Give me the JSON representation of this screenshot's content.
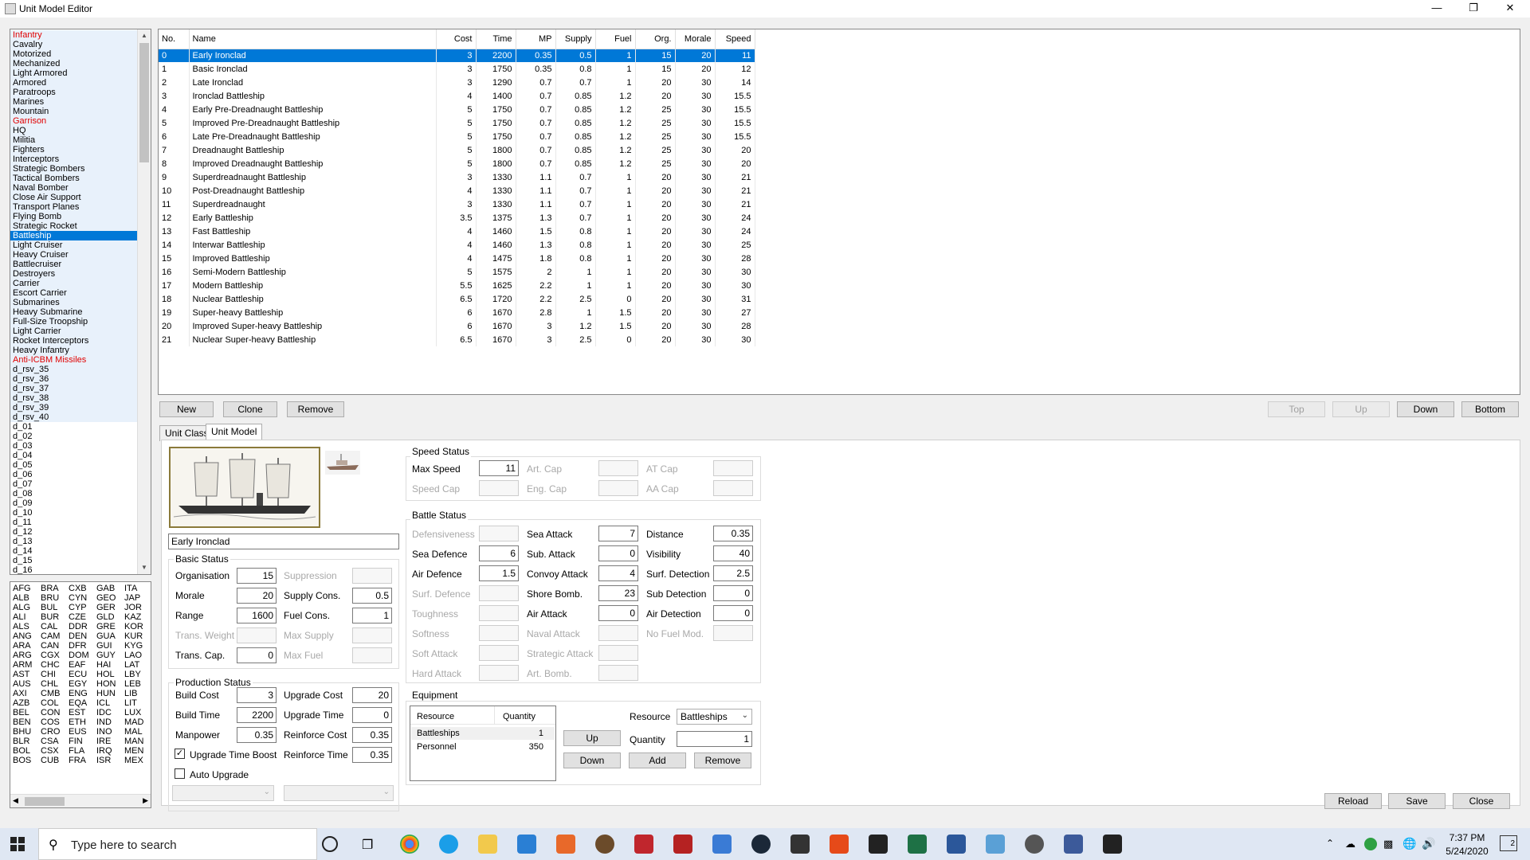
{
  "window": {
    "title": "Unit Model Editor"
  },
  "class_list": [
    {
      "label": "Infantry",
      "red": true
    },
    {
      "label": "Cavalry"
    },
    {
      "label": "Motorized"
    },
    {
      "label": "Mechanized"
    },
    {
      "label": "Light Armored"
    },
    {
      "label": "Armored"
    },
    {
      "label": "Paratroops"
    },
    {
      "label": "Marines"
    },
    {
      "label": "Mountain"
    },
    {
      "label": "Garrison",
      "red": true
    },
    {
      "label": "HQ"
    },
    {
      "label": "Militia"
    },
    {
      "label": "Fighters"
    },
    {
      "label": "Interceptors"
    },
    {
      "label": "Strategic Bombers"
    },
    {
      "label": "Tactical Bombers"
    },
    {
      "label": "Naval Bomber"
    },
    {
      "label": "Close Air Support"
    },
    {
      "label": "Transport Planes"
    },
    {
      "label": "Flying Bomb"
    },
    {
      "label": "Strategic Rocket"
    },
    {
      "label": "Battleship",
      "selected": true
    },
    {
      "label": "Light Cruiser"
    },
    {
      "label": "Heavy Cruiser"
    },
    {
      "label": "Battlecruiser"
    },
    {
      "label": "Destroyers"
    },
    {
      "label": "Carrier"
    },
    {
      "label": "Escort Carrier"
    },
    {
      "label": "Submarines"
    },
    {
      "label": "Heavy Submarine"
    },
    {
      "label": "Full-Size Troopship"
    },
    {
      "label": "Light Carrier"
    },
    {
      "label": "Rocket Interceptors"
    },
    {
      "label": "Heavy Infantry"
    },
    {
      "label": "Anti-ICBM Missiles",
      "red": true
    },
    {
      "label": "d_rsv_35"
    },
    {
      "label": "d_rsv_36"
    },
    {
      "label": "d_rsv_37"
    },
    {
      "label": "d_rsv_38"
    },
    {
      "label": "d_rsv_39"
    },
    {
      "label": "d_rsv_40"
    },
    {
      "label": "d_01",
      "plain": true
    },
    {
      "label": "d_02",
      "plain": true
    },
    {
      "label": "d_03",
      "plain": true
    },
    {
      "label": "d_04",
      "plain": true
    },
    {
      "label": "d_05",
      "plain": true
    },
    {
      "label": "d_06",
      "plain": true
    },
    {
      "label": "d_07",
      "plain": true
    },
    {
      "label": "d_08",
      "plain": true
    },
    {
      "label": "d_09",
      "plain": true
    },
    {
      "label": "d_10",
      "plain": true
    },
    {
      "label": "d_11",
      "plain": true
    },
    {
      "label": "d_12",
      "plain": true
    },
    {
      "label": "d_13",
      "plain": true
    },
    {
      "label": "d_14",
      "plain": true
    },
    {
      "label": "d_15",
      "plain": true
    },
    {
      "label": "d_16",
      "plain": true
    }
  ],
  "countries": [
    "AFG",
    "BRA",
    "CXB",
    "GAB",
    "ITA",
    "ALB",
    "BRU",
    "CYN",
    "GEO",
    "JAP",
    "ALG",
    "BUL",
    "CYP",
    "GER",
    "JOR",
    "ALI",
    "BUR",
    "CZE",
    "GLD",
    "KAZ",
    "ALS",
    "CAL",
    "DDR",
    "GRE",
    "KOR",
    "ANG",
    "CAM",
    "DEN",
    "GUA",
    "KUR",
    "ARA",
    "CAN",
    "DFR",
    "GUI",
    "KYG",
    "ARG",
    "CGX",
    "DOM",
    "GUY",
    "LAO",
    "ARM",
    "CHC",
    "EAF",
    "HAI",
    "LAT",
    "AST",
    "CHI",
    "ECU",
    "HOL",
    "LBY",
    "AUS",
    "CHL",
    "EGY",
    "HON",
    "LEB",
    "AXI",
    "CMB",
    "ENG",
    "HUN",
    "LIB",
    "AZB",
    "COL",
    "EQA",
    "ICL",
    "LIT",
    "BEL",
    "CON",
    "EST",
    "IDC",
    "LUX",
    "BEN",
    "COS",
    "ETH",
    "IND",
    "MAD",
    "BHU",
    "CRO",
    "EUS",
    "INO",
    "MAL",
    "BLR",
    "CSA",
    "FIN",
    "IRE",
    "MAN",
    "BOL",
    "CSX",
    "FLA",
    "IRQ",
    "MEN",
    "BOS",
    "CUB",
    "FRA",
    "ISR",
    "MEX"
  ],
  "table": {
    "headers": [
      "No.",
      "Name",
      "Cost",
      "Time",
      "MP",
      "Supply",
      "Fuel",
      "Org.",
      "Morale",
      "Speed"
    ],
    "rows": [
      [
        "0",
        "Early Ironclad",
        "3",
        "2200",
        "0.35",
        "0.5",
        "1",
        "15",
        "20",
        "11"
      ],
      [
        "1",
        "Basic Ironclad",
        "3",
        "1750",
        "0.35",
        "0.8",
        "1",
        "15",
        "20",
        "12"
      ],
      [
        "2",
        "Late Ironclad",
        "3",
        "1290",
        "0.7",
        "0.7",
        "1",
        "20",
        "30",
        "14"
      ],
      [
        "3",
        "Ironclad Battleship",
        "4",
        "1400",
        "0.7",
        "0.85",
        "1.2",
        "20",
        "30",
        "15.5"
      ],
      [
        "4",
        "Early Pre-Dreadnaught Battleship",
        "5",
        "1750",
        "0.7",
        "0.85",
        "1.2",
        "25",
        "30",
        "15.5"
      ],
      [
        "5",
        "Improved Pre-Dreadnaught Battleship",
        "5",
        "1750",
        "0.7",
        "0.85",
        "1.2",
        "25",
        "30",
        "15.5"
      ],
      [
        "6",
        "Late Pre-Dreadnaught Battleship",
        "5",
        "1750",
        "0.7",
        "0.85",
        "1.2",
        "25",
        "30",
        "15.5"
      ],
      [
        "7",
        "Dreadnaught Battleship",
        "5",
        "1800",
        "0.7",
        "0.85",
        "1.2",
        "25",
        "30",
        "20"
      ],
      [
        "8",
        "Improved Dreadnaught Battleship",
        "5",
        "1800",
        "0.7",
        "0.85",
        "1.2",
        "25",
        "30",
        "20"
      ],
      [
        "9",
        "Superdreadnaught Battleship",
        "3",
        "1330",
        "1.1",
        "0.7",
        "1",
        "20",
        "30",
        "21"
      ],
      [
        "10",
        "Post-Dreadnaught Battleship",
        "4",
        "1330",
        "1.1",
        "0.7",
        "1",
        "20",
        "30",
        "21"
      ],
      [
        "11",
        "Superdreadnaught",
        "3",
        "1330",
        "1.1",
        "0.7",
        "1",
        "20",
        "30",
        "21"
      ],
      [
        "12",
        "Early Battleship",
        "3.5",
        "1375",
        "1.3",
        "0.7",
        "1",
        "20",
        "30",
        "24"
      ],
      [
        "13",
        "Fast Battleship",
        "4",
        "1460",
        "1.5",
        "0.8",
        "1",
        "20",
        "30",
        "24"
      ],
      [
        "14",
        "Interwar Battleship",
        "4",
        "1460",
        "1.3",
        "0.8",
        "1",
        "20",
        "30",
        "25"
      ],
      [
        "15",
        "Improved Battleship",
        "4",
        "1475",
        "1.8",
        "0.8",
        "1",
        "20",
        "30",
        "28"
      ],
      [
        "16",
        "Semi-Modern Battleship",
        "5",
        "1575",
        "2",
        "1",
        "1",
        "20",
        "30",
        "30"
      ],
      [
        "17",
        "Modern Battleship",
        "5.5",
        "1625",
        "2.2",
        "1",
        "1",
        "20",
        "30",
        "30"
      ],
      [
        "18",
        "Nuclear Battleship",
        "6.5",
        "1720",
        "2.2",
        "2.5",
        "0",
        "20",
        "30",
        "31"
      ],
      [
        "19",
        "Super-heavy Battleship",
        "6",
        "1670",
        "2.8",
        "1",
        "1.5",
        "20",
        "30",
        "27"
      ],
      [
        "20",
        "Improved Super-heavy Battleship",
        "6",
        "1670",
        "3",
        "1.2",
        "1.5",
        "20",
        "30",
        "28"
      ],
      [
        "21",
        "Nuclear Super-heavy Battleship",
        "6.5",
        "1670",
        "3",
        "2.5",
        "0",
        "20",
        "30",
        "30"
      ]
    ]
  },
  "buttons": {
    "new": "New",
    "clone": "Clone",
    "remove": "Remove",
    "top": "Top",
    "up": "Up",
    "down": "Down",
    "bottom": "Bottom",
    "reload": "Reload",
    "save": "Save",
    "close": "Close"
  },
  "tabs": {
    "unit_class": "Unit Class",
    "unit_model": "Unit Model"
  },
  "model_name": "Early Ironclad",
  "basic_status": {
    "title": "Basic Status",
    "organisation": {
      "label": "Organisation",
      "value": "15"
    },
    "morale": {
      "label": "Morale",
      "value": "20"
    },
    "range": {
      "label": "Range",
      "value": "1600"
    },
    "trans_weight": {
      "label": "Trans. Weight",
      "value": ""
    },
    "trans_cap": {
      "label": "Trans. Cap.",
      "value": "0"
    },
    "suppression": {
      "label": "Suppression",
      "value": ""
    },
    "supply_cons": {
      "label": "Supply Cons.",
      "value": "0.5"
    },
    "fuel_cons": {
      "label": "Fuel Cons.",
      "value": "1"
    },
    "max_supply": {
      "label": "Max Supply",
      "value": ""
    },
    "max_fuel": {
      "label": "Max Fuel",
      "value": ""
    }
  },
  "production_status": {
    "title": "Production Status",
    "build_cost": {
      "label": "Build Cost",
      "value": "3"
    },
    "build_time": {
      "label": "Build Time",
      "value": "2200"
    },
    "manpower": {
      "label": "Manpower",
      "value": "0.35"
    },
    "upgrade_cost": {
      "label": "Upgrade Cost",
      "value": "20"
    },
    "upgrade_time": {
      "label": "Upgrade Time",
      "value": "0"
    },
    "reinforce_cost": {
      "label": "Reinforce Cost",
      "value": "0.35"
    },
    "reinforce_time": {
      "label": "Reinforce Time",
      "value": "0.35"
    },
    "upgrade_time_boost": "Upgrade Time Boost",
    "auto_upgrade": "Auto Upgrade"
  },
  "speed_status": {
    "title": "Speed Status",
    "max_speed": {
      "label": "Max Speed",
      "value": "11"
    },
    "speed_cap": {
      "label": "Speed Cap",
      "value": ""
    },
    "art_cap": {
      "label": "Art. Cap",
      "value": ""
    },
    "eng_cap": {
      "label": "Eng. Cap",
      "value": ""
    },
    "at_cap": {
      "label": "AT Cap",
      "value": ""
    },
    "aa_cap": {
      "label": "AA Cap",
      "value": ""
    }
  },
  "battle_status": {
    "title": "Battle Status",
    "col1": [
      {
        "label": "Defensiveness",
        "value": "",
        "dis": true
      },
      {
        "label": "Sea Defence",
        "value": "6"
      },
      {
        "label": "Air Defence",
        "value": "1.5"
      },
      {
        "label": "Surf. Defence",
        "value": "",
        "dis": true
      },
      {
        "label": "Toughness",
        "value": "",
        "dis": true
      },
      {
        "label": "Softness",
        "value": "",
        "dis": true
      },
      {
        "label": "Soft Attack",
        "value": "",
        "dis": true
      },
      {
        "label": "Hard Attack",
        "value": "",
        "dis": true
      }
    ],
    "col2": [
      {
        "label": "Sea Attack",
        "value": "7"
      },
      {
        "label": "Sub. Attack",
        "value": "0"
      },
      {
        "label": "Convoy Attack",
        "value": "4"
      },
      {
        "label": "Shore Bomb.",
        "value": "23"
      },
      {
        "label": "Air Attack",
        "value": "0"
      },
      {
        "label": "Naval Attack",
        "value": "",
        "dis": true
      },
      {
        "label": "Strategic Attack",
        "value": "",
        "dis": true
      },
      {
        "label": "Art. Bomb.",
        "value": "",
        "dis": true
      }
    ],
    "col3": [
      {
        "label": "Distance",
        "value": "0.35"
      },
      {
        "label": "Visibility",
        "value": "40"
      },
      {
        "label": "Surf. Detection",
        "value": "2.5"
      },
      {
        "label": "Sub Detection",
        "value": "0"
      },
      {
        "label": "Air Detection",
        "value": "0"
      },
      {
        "label": "No Fuel Mod.",
        "value": "",
        "dis": true
      }
    ]
  },
  "equipment": {
    "title": "Equipment",
    "headers": [
      "Resource",
      "Quantity"
    ],
    "rows": [
      [
        "Battleships",
        "1"
      ],
      [
        "Personnel",
        "350"
      ]
    ],
    "resource_label": "Resource",
    "resource_value": "Battleships",
    "quantity_label": "Quantity",
    "quantity_value": "1",
    "up": "Up",
    "down": "Down",
    "add": "Add",
    "remove": "Remove"
  },
  "taskbar": {
    "search_placeholder": "Type here to search",
    "time": "7:37 PM",
    "date": "5/24/2020",
    "notifications": "2"
  },
  "colors": {
    "accent": "#0078d7",
    "red_text": "#e00000"
  }
}
